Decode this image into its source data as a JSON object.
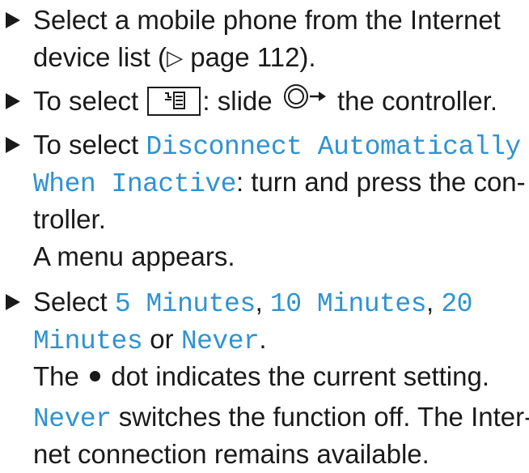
{
  "steps": [
    {
      "line1": "Select a mobile phone from the Internet",
      "line2_a": "device list (",
      "page_ref_symbol": "▷",
      "line2_b": " page 112)."
    },
    {
      "text_a": "To select ",
      "icon": "menu-list-icon",
      "text_b": ": slide ",
      "controller_icon": "controller-slide-right-icon",
      "text_c": " the controller."
    },
    {
      "mono_1": "Disconnect Automatically",
      "prefix": "To select ",
      "mono_2": "When Inactive",
      "text_after": ": turn and press the con-",
      "line3": "troller.",
      "result": "A menu appears."
    },
    {
      "prefix": "Select ",
      "opt1": "5 Minutes",
      "sep1": ", ",
      "opt2": "10 Minutes",
      "sep2": ", ",
      "opt3_a": "20",
      "opt3_b": "Minutes",
      "or": " or ",
      "opt4": "Never",
      "end": ".",
      "dot_a": "The ",
      "dot_b": " dot indicates the current setting.",
      "never_word": "Never",
      "never_a": " switches the function off. The Inter-",
      "never_b": "net connection remains available."
    }
  ],
  "colors": {
    "accent": "#2f93d1",
    "text": "#1a1a1a"
  }
}
